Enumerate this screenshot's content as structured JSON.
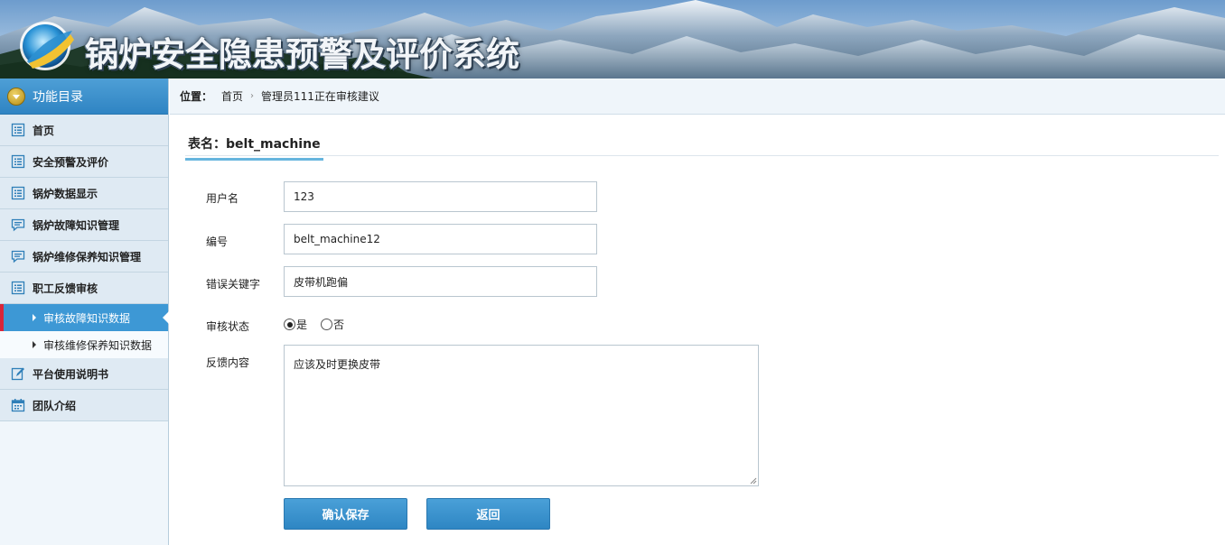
{
  "header": {
    "app_title": "锅炉安全隐患预警及评价系统"
  },
  "sidebar": {
    "title": "功能目录",
    "items": [
      {
        "label": "首页",
        "icon": "list-icon"
      },
      {
        "label": "安全预警及评价",
        "icon": "list-icon"
      },
      {
        "label": "锅炉数据显示",
        "icon": "list-icon"
      },
      {
        "label": "锅炉故障知识管理",
        "icon": "chat-icon"
      },
      {
        "label": "锅炉维修保养知识管理",
        "icon": "chat-icon"
      },
      {
        "label": "职工反馈审核",
        "icon": "list-icon"
      },
      {
        "label": "平台使用说明书",
        "icon": "edit-icon"
      },
      {
        "label": "团队介绍",
        "icon": "calendar-icon"
      }
    ],
    "subitems": [
      {
        "label": "审核故障知识数据",
        "active": true
      },
      {
        "label": "审核维修保养知识数据",
        "active": false
      }
    ]
  },
  "breadcrumb": {
    "prefix": "位置：",
    "home": "首页",
    "current": "管理员111正在审核建议"
  },
  "form": {
    "table_title": "表名：belt_machine",
    "username_label": "用户名",
    "username_value": "123",
    "number_label": "编号",
    "number_value": "belt_machine12",
    "keyword_label": "错误关键字",
    "keyword_value": "皮带机跑偏",
    "status_label": "审核状态",
    "status_yes": "是",
    "status_no": "否",
    "status_selected": "是",
    "feedback_label": "反馈内容",
    "feedback_value": "应该及时更换皮带",
    "save_label": "确认保存",
    "back_label": "返回"
  },
  "colors": {
    "accent_blue": "#3d98d5",
    "active_marker": "#d9263a",
    "sidebar_bg": "#dfeaf3"
  }
}
